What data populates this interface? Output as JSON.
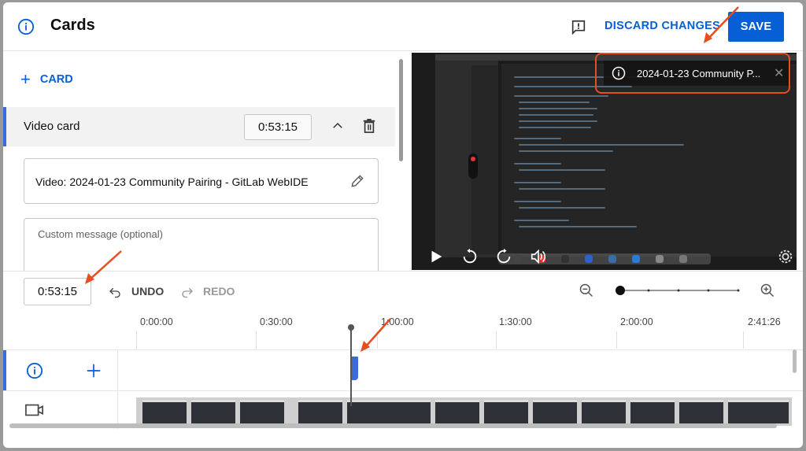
{
  "header": {
    "title": "Cards",
    "discard_label": "DISCARD CHANGES",
    "save_label": "SAVE"
  },
  "left_panel": {
    "add_card_label": "CARD",
    "card": {
      "type_label": "Video card",
      "time": "0:53:15",
      "video_field": "Video: 2024-01-23 Community Pairing - GitLab WebIDE",
      "custom_message_placeholder": "Custom message (optional)"
    }
  },
  "player": {
    "card_teaser_text": "2024-01-23 Community P..."
  },
  "timeline_toolbar": {
    "current_time": "0:53:15",
    "undo_label": "UNDO",
    "redo_label": "REDO"
  },
  "timeline": {
    "ruler_labels": [
      "0:00:00",
      "0:30:00",
      "1:00:00",
      "1:30:00",
      "2:00:00",
      "2:41:26"
    ]
  },
  "colors": {
    "accent": "#065fd4",
    "lane_accent": "#3e6ae1",
    "annotation_red": "#e84d1d"
  },
  "icons": [
    "info-icon",
    "feedback-icon",
    "plus-icon",
    "chevron-up-icon",
    "trash-icon",
    "pencil-icon",
    "play-icon",
    "rewind-10-icon",
    "forward-10-icon",
    "volume-icon",
    "settings-icon",
    "undo-icon",
    "redo-icon",
    "zoom-out-icon",
    "zoom-in-icon",
    "camera-icon",
    "close-icon"
  ]
}
